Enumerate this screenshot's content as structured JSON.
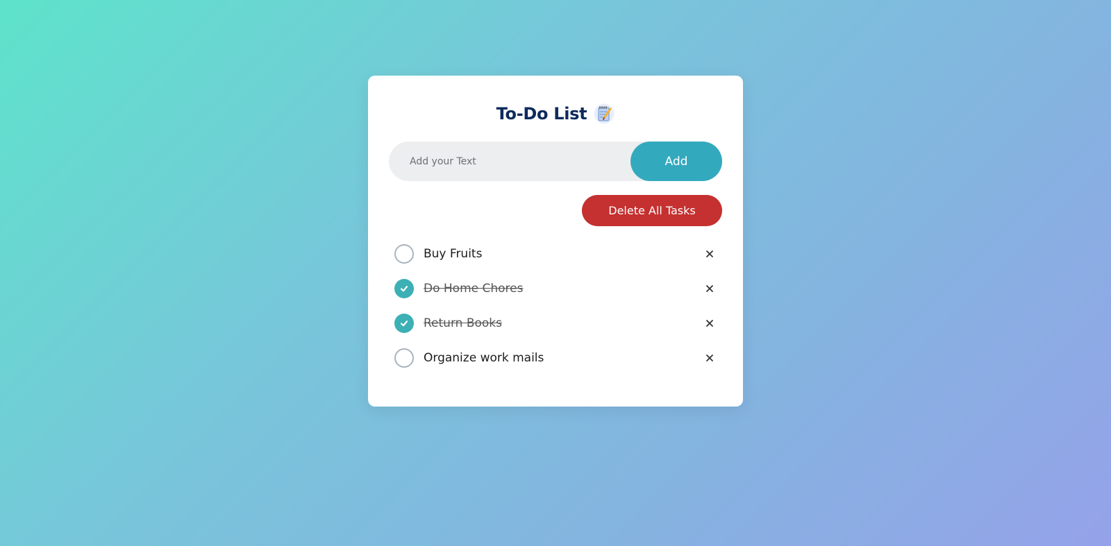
{
  "app": {
    "title": "To-Do List",
    "title_icon": "notepad-icon"
  },
  "input": {
    "placeholder": "Add your Text",
    "value": ""
  },
  "buttons": {
    "add_label": "Add",
    "delete_all_label": "Delete All Tasks"
  },
  "tasks": [
    {
      "label": "Buy Fruits",
      "done": false
    },
    {
      "label": "Do Home Chores",
      "done": true
    },
    {
      "label": "Return Books",
      "done": true
    },
    {
      "label": "Organize work mails",
      "done": false
    }
  ],
  "icons": {
    "check": "check-icon",
    "remove": "close-icon"
  },
  "colors": {
    "title": "#0d2a5c",
    "add_button": "#33a9bd",
    "delete_button": "#c53030",
    "checked": "#3cb0b4",
    "unchecked_border": "#a8b4c0",
    "background_start": "#5ee3cb",
    "background_end": "#95a2e9"
  }
}
